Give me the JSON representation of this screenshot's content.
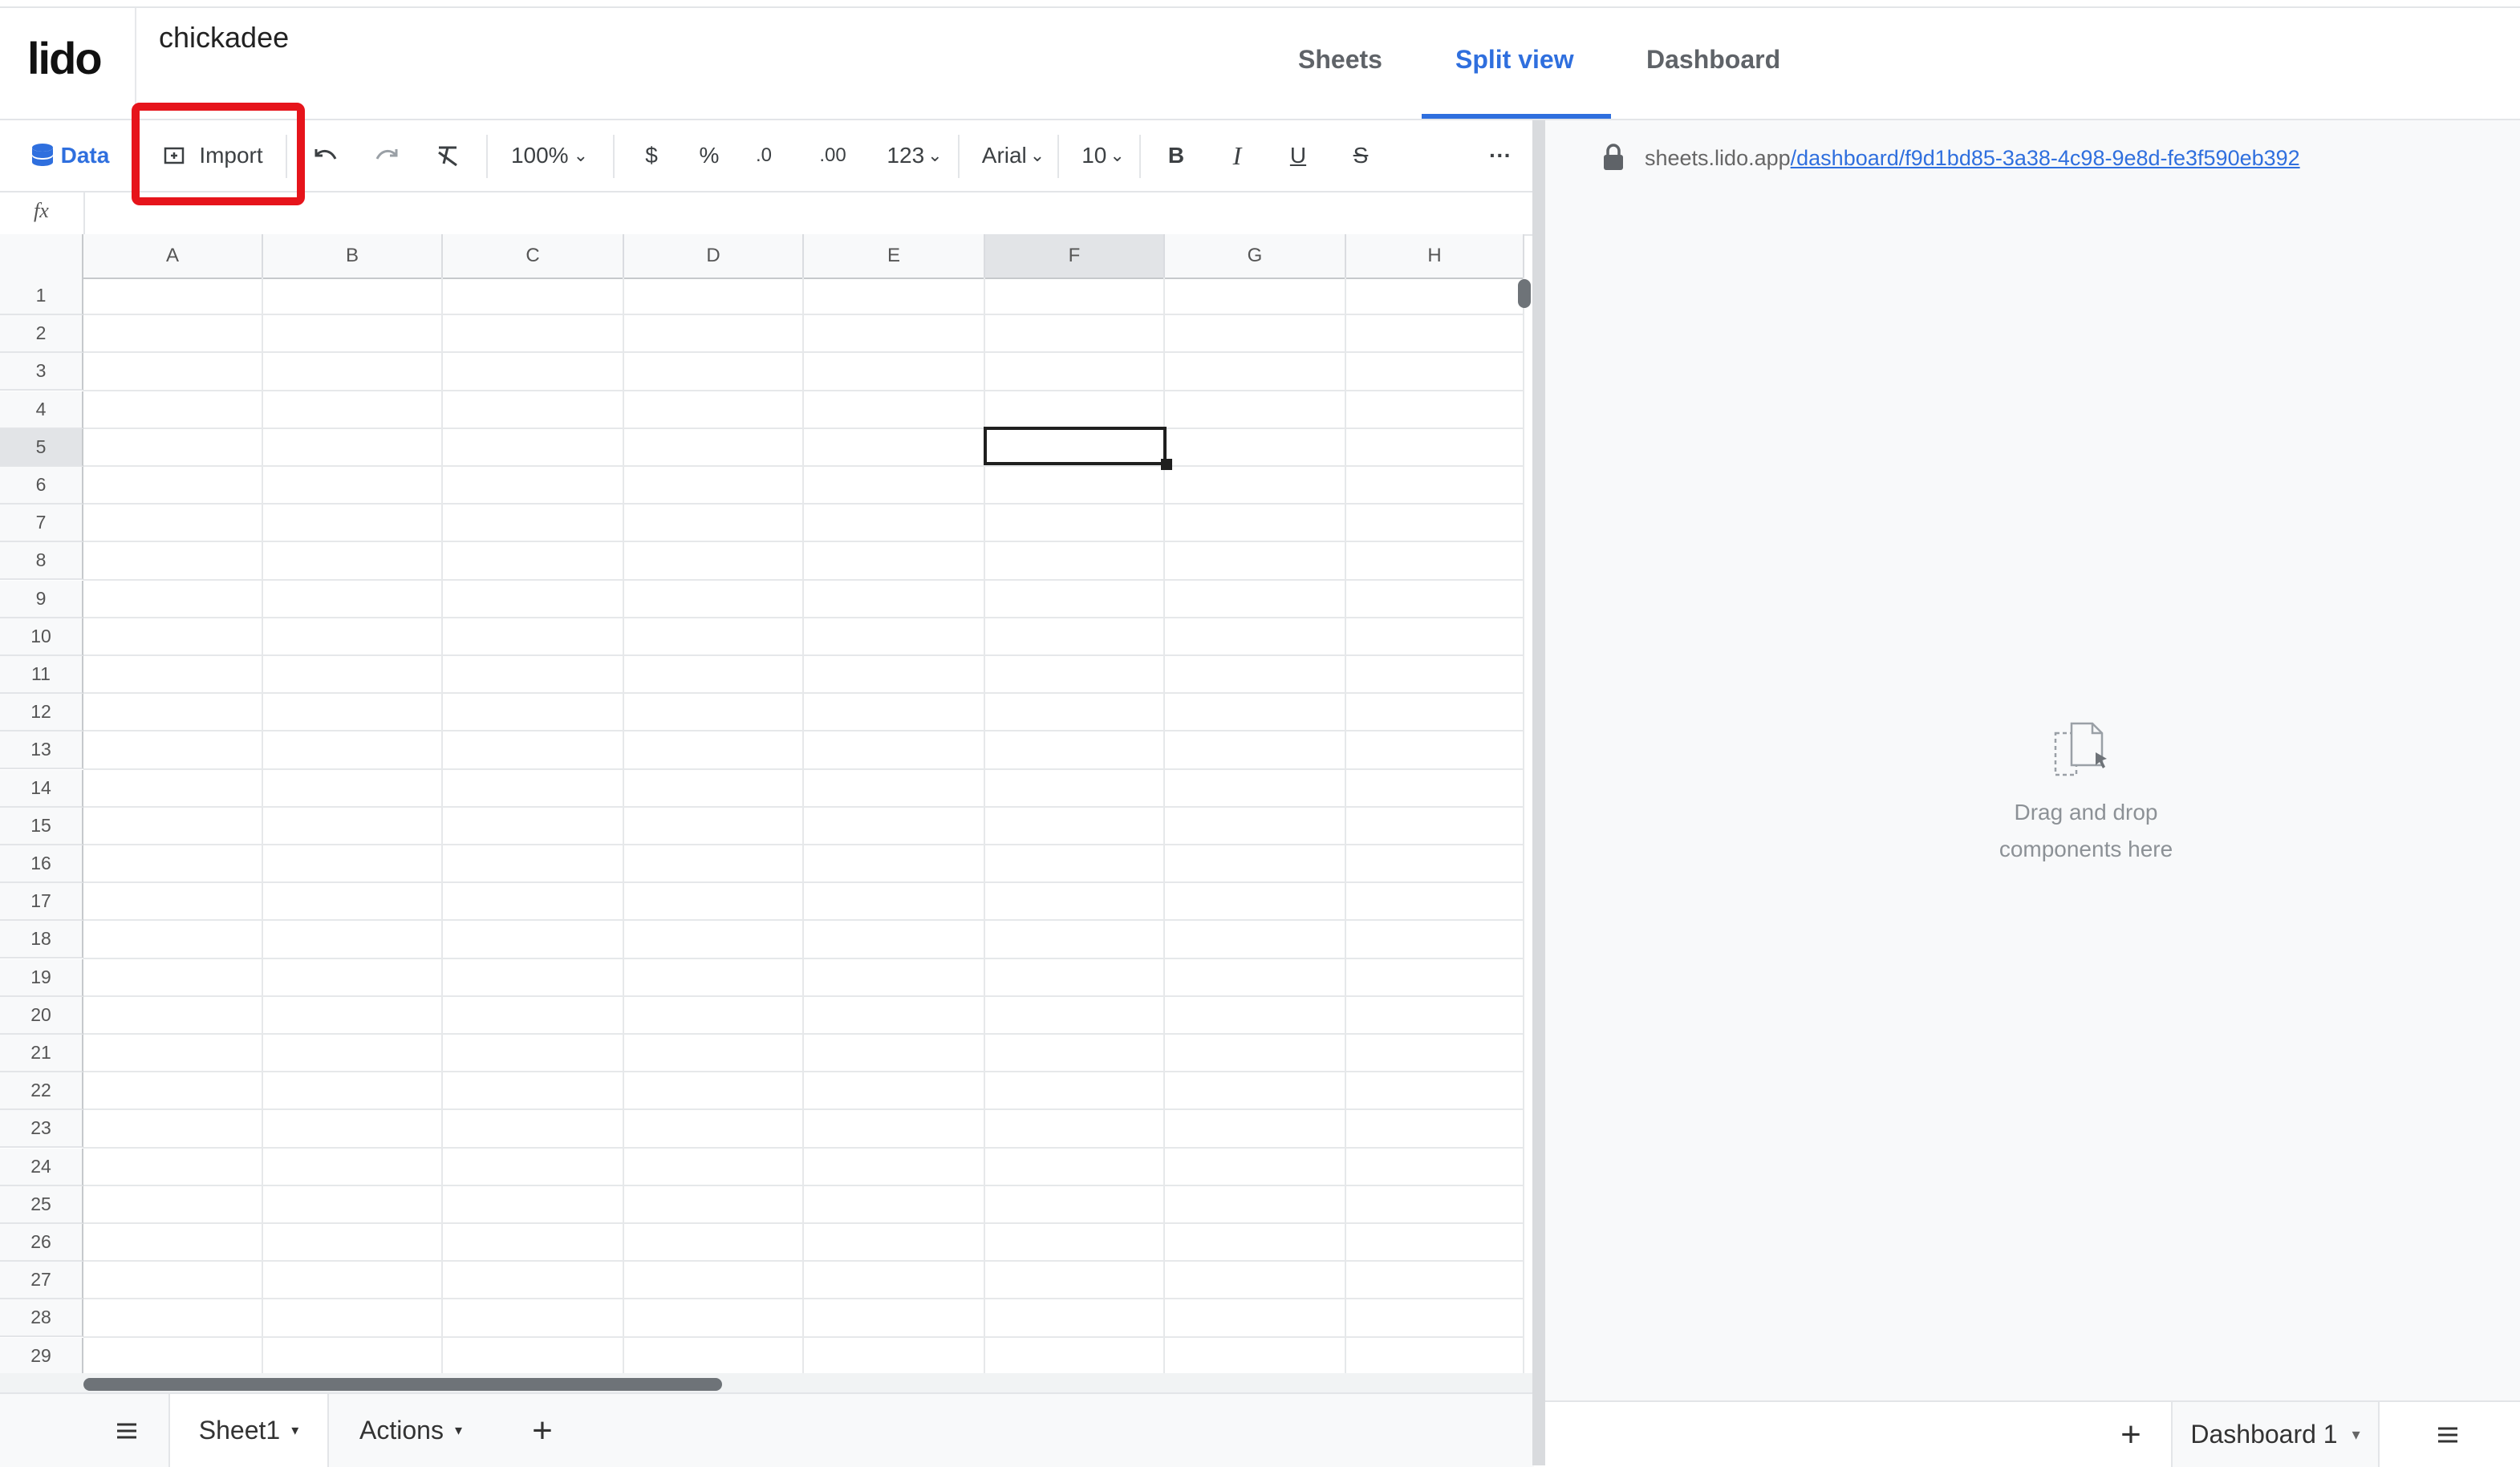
{
  "header": {
    "logo": "lido",
    "doc_title": "chickadee",
    "tabs": [
      {
        "label": "Sheets",
        "active": false
      },
      {
        "label": "Split view",
        "active": true
      },
      {
        "label": "Dashboard",
        "active": false
      }
    ]
  },
  "toolbar": {
    "data_label": "Data",
    "import_label": "Import",
    "zoom": "100%",
    "currency": "$",
    "percent": "%",
    "decrease_decimal": ".0",
    "increase_decimal": ".00",
    "number_format": "123",
    "font": "Arial",
    "font_size": "10",
    "bold": "B",
    "italic": "I",
    "underline": "U",
    "strike": "S",
    "more": "···"
  },
  "formula_bar": {
    "label": "fx",
    "value": ""
  },
  "grid": {
    "columns": [
      "A",
      "B",
      "C",
      "D",
      "E",
      "F",
      "G",
      "H"
    ],
    "rows": [
      "1",
      "2",
      "3",
      "4",
      "5",
      "6",
      "7",
      "8",
      "9",
      "10",
      "11",
      "12",
      "13",
      "14",
      "15",
      "16",
      "17",
      "18",
      "19",
      "20",
      "21",
      "22",
      "23",
      "24",
      "25",
      "26",
      "27",
      "28",
      "29"
    ],
    "selected_cell": "F5"
  },
  "sheets": {
    "menu_icon": "hamburger-icon",
    "tabs": [
      {
        "label": "Sheet1",
        "active": true
      },
      {
        "label": "Actions",
        "active": false
      }
    ],
    "add_label": "+"
  },
  "right_panel": {
    "url_prefix": "sheets.lido.app",
    "url_link": "/dashboard/f9d1bd85-3a38-4c98-9e8d-fe3f590eb392",
    "dnd_line1": "Drag and drop",
    "dnd_line2": "components here",
    "add_label": "+",
    "dashboard_tab": "Dashboard 1"
  },
  "colors": {
    "accent": "#2f6fde",
    "highlight": "#e6141b"
  }
}
